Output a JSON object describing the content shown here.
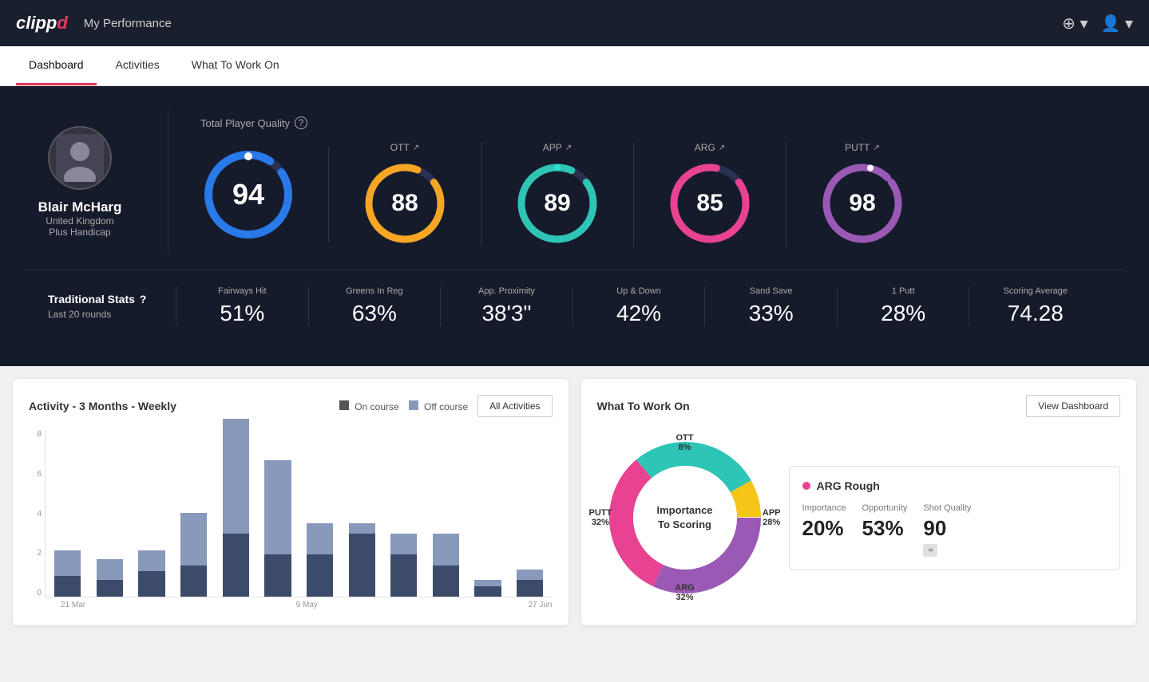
{
  "header": {
    "logo": "clippd",
    "title": "My Performance",
    "add_icon": "⊕",
    "avatar_icon": "👤"
  },
  "tabs": [
    {
      "label": "Dashboard",
      "active": true
    },
    {
      "label": "Activities",
      "active": false
    },
    {
      "label": "What To Work On",
      "active": false
    }
  ],
  "hero": {
    "player": {
      "name": "Blair McHarg",
      "country": "United Kingdom",
      "handicap": "Plus Handicap"
    },
    "total_quality": {
      "label": "Total Player Quality",
      "value": 94,
      "color": "#2979e8"
    },
    "scores": [
      {
        "label": "OTT",
        "value": 88,
        "color": "#f5a623"
      },
      {
        "label": "APP",
        "value": 89,
        "color": "#2ec4b6"
      },
      {
        "label": "ARG",
        "value": 85,
        "color": "#e84393"
      },
      {
        "label": "PUTT",
        "value": 98,
        "color": "#9b59b6"
      }
    ]
  },
  "trad_stats": {
    "label": "Traditional Stats",
    "sub": "Last 20 rounds",
    "items": [
      {
        "name": "Fairways Hit",
        "value": "51%"
      },
      {
        "name": "Greens In Reg",
        "value": "63%"
      },
      {
        "name": "App. Proximity",
        "value": "38'3\""
      },
      {
        "name": "Up & Down",
        "value": "42%"
      },
      {
        "name": "Sand Save",
        "value": "33%"
      },
      {
        "name": "1 Putt",
        "value": "28%"
      },
      {
        "name": "Scoring Average",
        "value": "74.28"
      }
    ]
  },
  "activity_chart": {
    "title": "Activity - 3 Months - Weekly",
    "legend": {
      "on_course": "On course",
      "off_course": "Off course"
    },
    "all_button": "All Activities",
    "y_labels": [
      "8",
      "6",
      "4",
      "2",
      "0"
    ],
    "x_labels": [
      "21 Mar",
      "9 May",
      "27 Jun"
    ],
    "bars": [
      {
        "on": 1,
        "off": 1.2
      },
      {
        "on": 0.8,
        "off": 1
      },
      {
        "on": 1.2,
        "off": 1
      },
      {
        "on": 1.5,
        "off": 2.5
      },
      {
        "on": 3,
        "off": 5.5
      },
      {
        "on": 2,
        "off": 4.5
      },
      {
        "on": 2,
        "off": 1.5
      },
      {
        "on": 3,
        "off": 0.5
      },
      {
        "on": 2,
        "off": 1
      },
      {
        "on": 1.5,
        "off": 1.5
      },
      {
        "on": 0.5,
        "off": 0.3
      },
      {
        "on": 0.8,
        "off": 0.5
      }
    ]
  },
  "what_to_work_on": {
    "title": "What To Work On",
    "view_button": "View Dashboard",
    "donut": {
      "center_line1": "Importance",
      "center_line2": "To Scoring",
      "segments": [
        {
          "label": "OTT",
          "percent": "8%",
          "color": "#f5c518"
        },
        {
          "label": "APP",
          "percent": "28%",
          "color": "#2ec4b6"
        },
        {
          "label": "ARG",
          "percent": "32%",
          "color": "#e84393"
        },
        {
          "label": "PUTT",
          "percent": "32%",
          "color": "#9b59b6"
        }
      ]
    },
    "card": {
      "title": "ARG Rough",
      "dot_color": "#e84393",
      "metrics": [
        {
          "label": "Importance",
          "value": "20%"
        },
        {
          "label": "Opportunity",
          "value": "53%"
        },
        {
          "label": "Shot Quality",
          "value": "90",
          "badge": "≈"
        }
      ]
    }
  }
}
